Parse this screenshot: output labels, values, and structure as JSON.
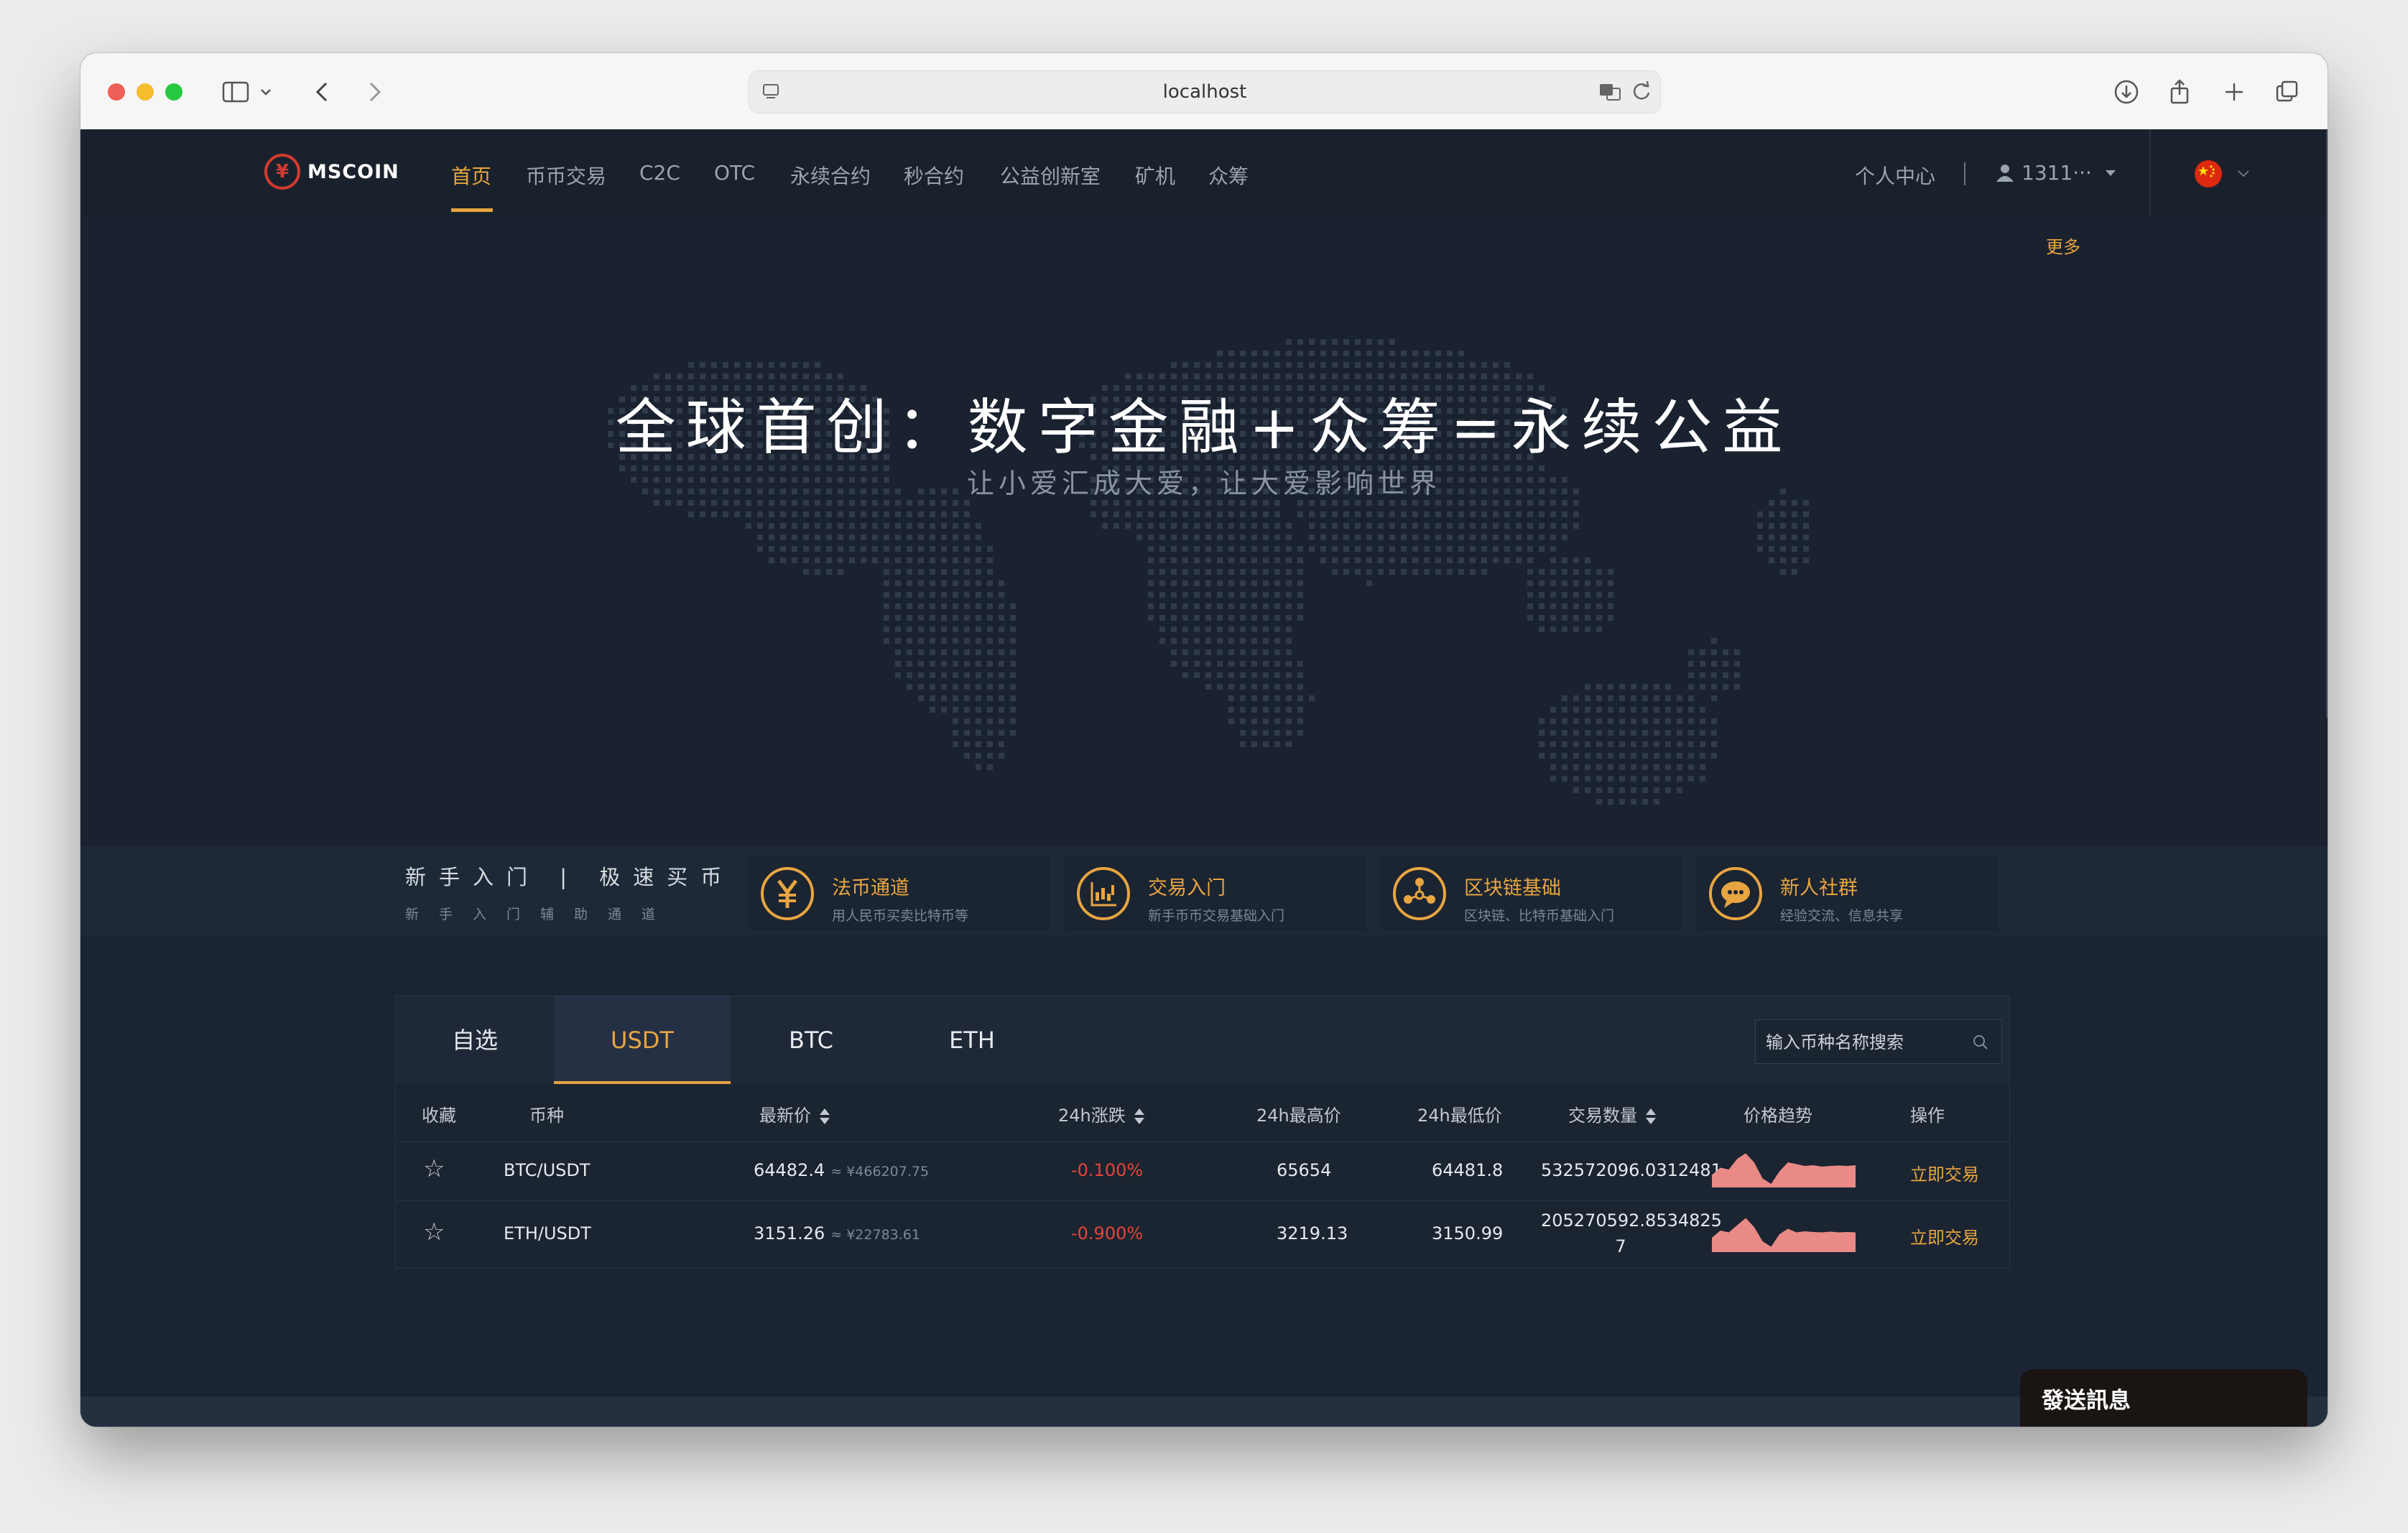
{
  "browser": {
    "url": "localhost"
  },
  "nav": {
    "logo_text": "MSCOIN",
    "logo_symbol": "¥",
    "items": [
      {
        "label": "首页",
        "active": true
      },
      {
        "label": "币币交易"
      },
      {
        "label": "C2C"
      },
      {
        "label": "OTC"
      },
      {
        "label": "永续合约"
      },
      {
        "label": "秒合约"
      },
      {
        "label": "公益创新室"
      },
      {
        "label": "矿机"
      },
      {
        "label": "众筹"
      }
    ],
    "personal_center": "个人中心",
    "user_label": "1311···",
    "language_flag": "cn-flag-icon"
  },
  "subbar": {
    "more": "更多"
  },
  "hero": {
    "title": "全球首创：数字金融+众筹=永续公益",
    "subtitle": "让小爱汇成大爱，让大爱影响世界"
  },
  "quick": {
    "left_title": "新手入门 | 极速买币",
    "left_sub": "新手入门辅助通道",
    "cards": [
      {
        "title": "法币通道",
        "desc": "用人民币买卖比特币等",
        "icon": "yen-icon"
      },
      {
        "title": "交易入门",
        "desc": "新手币币交易基础入门",
        "icon": "chart-icon"
      },
      {
        "title": "区块链基础",
        "desc": "区块链、比特币基础入门",
        "icon": "blockchain-icon"
      },
      {
        "title": "新人社群",
        "desc": "经验交流、信息共享",
        "icon": "chat-icon"
      }
    ]
  },
  "market": {
    "tabs": [
      {
        "label": "自选"
      },
      {
        "label": "USDT",
        "active": true
      },
      {
        "label": "BTC"
      },
      {
        "label": "ETH"
      }
    ],
    "search_placeholder": "输入币种名称搜索",
    "headers": {
      "fav": "收藏",
      "coin": "币种",
      "price": "最新价",
      "change": "24h涨跌",
      "high": "24h最高价",
      "low": "24h最低价",
      "volume": "交易数量",
      "trend": "价格趋势",
      "action": "操作"
    },
    "rows": [
      {
        "pair": "BTC/USDT",
        "price": "64482.4",
        "cny": "≈ ¥466207.75",
        "change": "-0.100%",
        "high": "65654",
        "low": "64481.8",
        "volume_line1": "532572096.0312481",
        "volume_line2": "",
        "action": "立即交易",
        "trend": [
          0.35,
          0.55,
          0.5,
          0.8,
          0.95,
          0.7,
          0.25,
          0.1,
          0.45,
          0.7,
          0.65,
          0.6,
          0.62,
          0.58,
          0.6,
          0.61,
          0.6,
          0.62
        ]
      },
      {
        "pair": "ETH/USDT",
        "price": "3151.26",
        "cny": "≈ ¥22783.61",
        "change": "-0.900%",
        "high": "3219.13",
        "low": "3150.99",
        "volume_line1": "205270592.8534825",
        "volume_line2": "7",
        "action": "立即交易",
        "trend": [
          0.4,
          0.6,
          0.55,
          0.75,
          0.95,
          0.7,
          0.3,
          0.15,
          0.5,
          0.65,
          0.55,
          0.58,
          0.56,
          0.55,
          0.57,
          0.55,
          0.56,
          0.55
        ]
      }
    ]
  },
  "colors": {
    "accent": "#e8a541",
    "negative": "#e0463a",
    "sparkline": "#e98a86",
    "logo_red": "#d23b2e"
  },
  "chat": {
    "label": "發送訊息"
  }
}
